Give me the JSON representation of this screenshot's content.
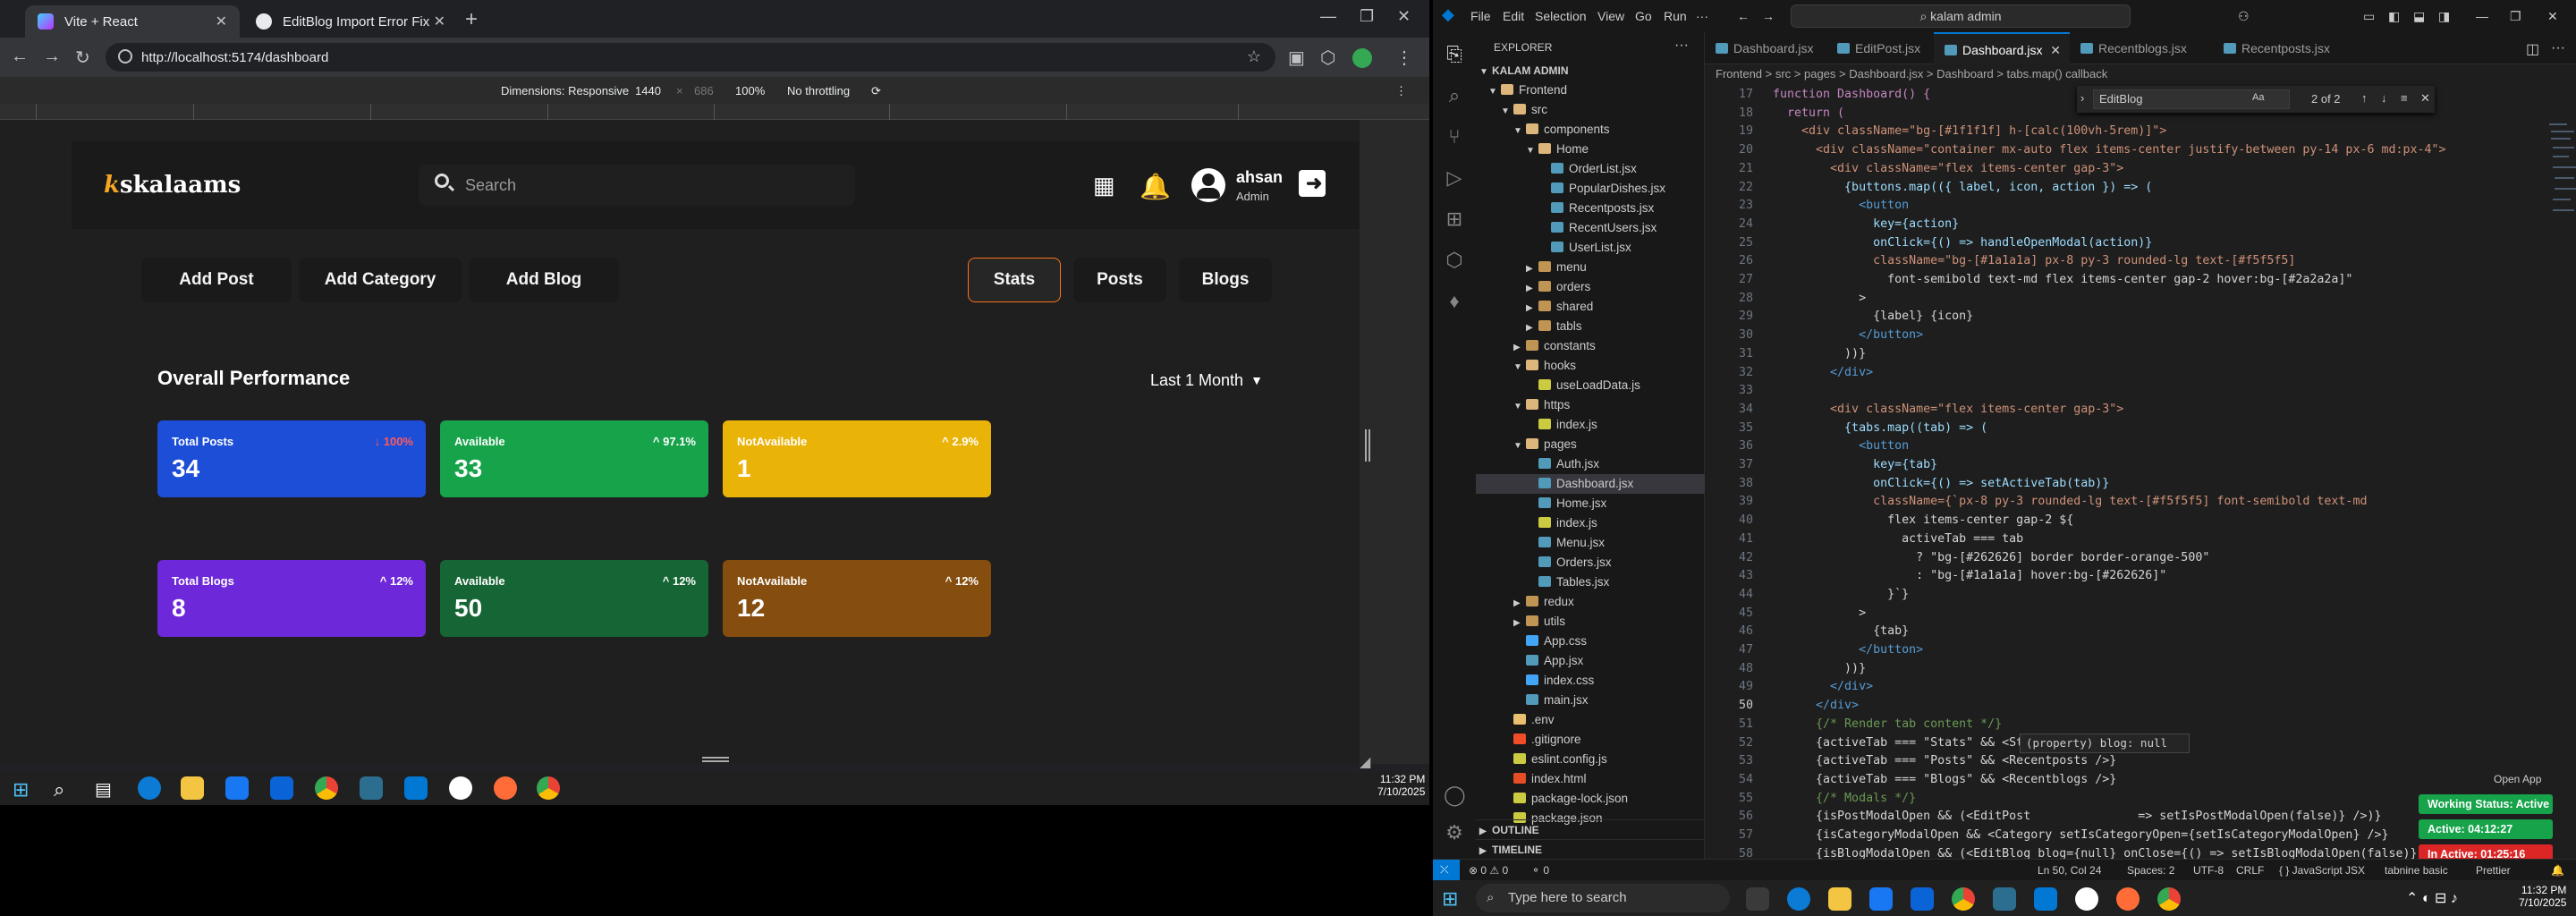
{
  "browser": {
    "tabs": [
      {
        "title": "Vite + React",
        "active": true
      },
      {
        "title": "EditBlog Import Error Fix",
        "active": false
      }
    ],
    "url": "http://localhost:5174/dashboard",
    "devtools": {
      "dimensions_label": "Dimensions: Responsive",
      "width": "1440",
      "height": "686",
      "zoom": "100%",
      "throttle": "No throttling"
    }
  },
  "app": {
    "logo": "skalaams",
    "search_placeholder": "Search",
    "user": {
      "name": "ahsan",
      "role": "Admin"
    },
    "actions": [
      "Add Post",
      "Add Category",
      "Add Blog"
    ],
    "tabs": [
      "Stats",
      "Posts",
      "Blogs"
    ],
    "active_tab": "Stats",
    "section_title": "Overall Performance",
    "period": "Last 1 Month",
    "cards": [
      {
        "label": "Total Posts",
        "value": "34",
        "pct": "↓ 100%",
        "color": "#1d4ed8"
      },
      {
        "label": "Available",
        "value": "33",
        "pct": "^ 97.1%",
        "color": "#16a34a"
      },
      {
        "label": "NotAvailable",
        "value": "1",
        "pct": "^ 2.9%",
        "color": "#eab308"
      },
      {
        "label": "Total Blogs",
        "value": "8",
        "pct": "^ 12%",
        "color": "#6d28d9"
      },
      {
        "label": "Available",
        "value": "50",
        "pct": "^ 12%",
        "color": "#166534"
      },
      {
        "label": "NotAvailable",
        "value": "12",
        "pct": "^ 12%",
        "color": "#854d0e"
      }
    ]
  },
  "taskbar_left": {
    "time": "11:32 PM",
    "date": "7/10/2025"
  },
  "vscode": {
    "menu": [
      "File",
      "Edit",
      "Selection",
      "View",
      "Go",
      "Run"
    ],
    "command_center": "kalam admin",
    "explorer_title": "EXPLORER",
    "project": "KALAM ADMIN",
    "tree": [
      {
        "name": "Frontend",
        "type": "folder-open",
        "depth": 0
      },
      {
        "name": "src",
        "type": "folder-open",
        "depth": 1
      },
      {
        "name": "components",
        "type": "folder-open",
        "depth": 2
      },
      {
        "name": "Home",
        "type": "folder-open",
        "depth": 3
      },
      {
        "name": "OrderList.jsx",
        "type": "jsx",
        "depth": 4
      },
      {
        "name": "PopularDishes.jsx",
        "type": "jsx",
        "depth": 4
      },
      {
        "name": "Recentposts.jsx",
        "type": "jsx",
        "depth": 4
      },
      {
        "name": "RecentUsers.jsx",
        "type": "jsx",
        "depth": 4
      },
      {
        "name": "UserList.jsx",
        "type": "jsx",
        "depth": 4
      },
      {
        "name": "menu",
        "type": "folder",
        "depth": 3
      },
      {
        "name": "orders",
        "type": "folder",
        "depth": 3
      },
      {
        "name": "shared",
        "type": "folder",
        "depth": 3
      },
      {
        "name": "tabls",
        "type": "folder",
        "depth": 3
      },
      {
        "name": "constants",
        "type": "folder",
        "depth": 2
      },
      {
        "name": "hooks",
        "type": "folder-open",
        "depth": 2
      },
      {
        "name": "useLoadData.js",
        "type": "js",
        "depth": 3
      },
      {
        "name": "https",
        "type": "folder-open",
        "depth": 2
      },
      {
        "name": "index.js",
        "type": "js",
        "depth": 3
      },
      {
        "name": "pages",
        "type": "folder-open",
        "depth": 2
      },
      {
        "name": "Auth.jsx",
        "type": "jsx",
        "depth": 3
      },
      {
        "name": "Dashboard.jsx",
        "type": "jsx",
        "depth": 3,
        "selected": true
      },
      {
        "name": "Home.jsx",
        "type": "jsx",
        "depth": 3
      },
      {
        "name": "index.js",
        "type": "js",
        "depth": 3
      },
      {
        "name": "Menu.jsx",
        "type": "jsx",
        "depth": 3
      },
      {
        "name": "Orders.jsx",
        "type": "jsx",
        "depth": 3
      },
      {
        "name": "Tables.jsx",
        "type": "jsx",
        "depth": 3
      },
      {
        "name": "redux",
        "type": "folder",
        "depth": 2
      },
      {
        "name": "utils",
        "type": "folder",
        "depth": 2
      },
      {
        "name": "App.css",
        "type": "css",
        "depth": 2
      },
      {
        "name": "App.jsx",
        "type": "jsx",
        "depth": 2
      },
      {
        "name": "index.css",
        "type": "css",
        "depth": 2
      },
      {
        "name": "main.jsx",
        "type": "jsx",
        "depth": 2
      },
      {
        "name": ".env",
        "type": "env",
        "depth": 1
      },
      {
        "name": ".gitignore",
        "type": "git",
        "depth": 1
      },
      {
        "name": "eslint.config.js",
        "type": "js",
        "depth": 1
      },
      {
        "name": "index.html",
        "type": "html",
        "depth": 1
      },
      {
        "name": "package-lock.json",
        "type": "json",
        "depth": 1
      },
      {
        "name": "package.json",
        "type": "json",
        "depth": 1
      }
    ],
    "outline": "OUTLINE",
    "timeline": "TIMELINE",
    "editor_tabs": [
      "Dashboard.jsx",
      "EditPost.jsx",
      "Dashboard.jsx",
      "Recentblogs.jsx",
      "Recentposts.jsx"
    ],
    "active_editor_tab": 2,
    "breadcrumb": "Frontend > src > pages > Dashboard.jsx > Dashboard > tabs.map() callback",
    "find": {
      "query": "EditBlog",
      "count": "2 of 2"
    },
    "code_start_line": 17,
    "current_line": 50,
    "code_lines": [
      "function Dashboard() {",
      "  return (",
      "    <div className=\"bg-[#1f1f1f] h-[calc(100vh-5rem)]\">",
      "      <div className=\"container mx-auto flex items-center justify-between py-14 px-6 md:px-4\">",
      "        <div className=\"flex items-center gap-3\">",
      "          {buttons.map(({ label, icon, action }) => (",
      "            <button",
      "              key={action}",
      "              onClick={() => handleOpenModal(action)}",
      "              className=\"bg-[#1a1a1a] px-8 py-3 rounded-lg text-[#f5f5f5]",
      "                font-semibold text-md flex items-center gap-2 hover:bg-[#2a2a2a]\"",
      "            >",
      "              {label} {icon}",
      "            </button>",
      "          ))}",
      "        </div>",
      "",
      "        <div className=\"flex items-center gap-3\">",
      "          {tabs.map((tab) => (",
      "            <button",
      "              key={tab}",
      "              onClick={() => setActiveTab(tab)}",
      "              className={`px-8 py-3 rounded-lg text-[#f5f5f5] font-semibold text-md",
      "                flex items-center gap-2 ${",
      "                  activeTab === tab",
      "                    ? \"bg-[#262626] border border-orange-500\"",
      "                    : \"bg-[#1a1a1a] hover:bg-[#262626]\"",
      "                }`}",
      "            >",
      "              {tab}",
      "            </button>",
      "          ))}",
      "        </div>",
      "      </div>",
      "      {/* Render tab content */}",
      "      {activeTab === \"Stats\" && <Stats />}",
      "      {activeTab === \"Posts\" && <Recentposts />}",
      "      {activeTab === \"Blogs\" && <Recentblogs />}",
      "      {/* Modals */}",
      "      {isPostModalOpen && (<EditPost               => setIsPostModalOpen(false)} />)}",
      "      {isCategoryModalOpen && <Category setIsCategoryOpen={setIsCategoryModalOpen} />}",
      "      {isBlogModalOpen && (<EditBlog blog={null} onClose={() => setIsBlogModalOpen(false)} />)}",
      "",
      "    </div>",
      "  );",
      "}"
    ],
    "hover_tip": "(property) blog: null",
    "open_app": "Open App",
    "notifications": [
      {
        "text": "Working Status: Active",
        "color": "#16a34a"
      },
      {
        "text": "Active: 04:12:27",
        "color": "#16a34a"
      },
      {
        "text": "In Active: 01:25:16",
        "color": "#dc2626"
      }
    ],
    "status": {
      "problems": "⊗ 0  ⚠ 0",
      "ports": "⚬ 0",
      "position": "Ln 50, Col 24",
      "spaces": "Spaces: 2",
      "encoding": "UTF-8",
      "eol": "CRLF",
      "language": "{ } JavaScript JSX",
      "extra": "tabnine basic",
      "prettier": "Prettier"
    }
  },
  "taskbar_right": {
    "search_placeholder": "Type here to search",
    "time": "11:32 PM",
    "date": "7/10/2025"
  }
}
